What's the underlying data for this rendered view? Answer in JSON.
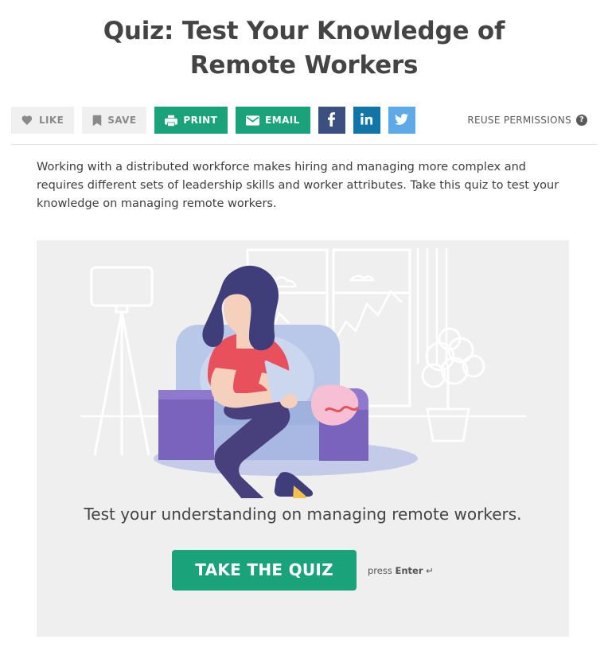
{
  "page": {
    "title": "Quiz: Test Your Knowledge of Remote Workers",
    "intro": "Working with a distributed workforce makes hiring and managing more complex and requires different sets of leadership skills and worker attributes. Take this quiz to test your knowledge on managing remote workers."
  },
  "toolbar": {
    "like_label": "LIKE",
    "save_label": "SAVE",
    "print_label": "PRINT",
    "email_label": "EMAIL",
    "facebook_label": "f",
    "linkedin_label": "in",
    "twitter_label": "twitter-bird",
    "reuse_label": "REUSE PERMISSIONS",
    "reuse_help_glyph": "?",
    "icons": {
      "like": "heart-icon",
      "save": "bookmark-icon",
      "print": "printer-icon",
      "email": "envelope-icon",
      "facebook": "facebook-icon",
      "linkedin": "linkedin-icon",
      "twitter": "twitter-icon",
      "reuse": "question-circle-icon"
    },
    "colors": {
      "gray_button_bg": "#f0f0f0",
      "gray_button_text": "#8a8a8a",
      "green": "#1aa37a",
      "facebook": "#3b4f81",
      "linkedin": "#1275a8",
      "twitter": "#5eaae8"
    }
  },
  "quiz": {
    "caption": "Test your understanding on managing remote workers.",
    "cta_label": "TAKE THE QUIZ",
    "hint_prefix": "press ",
    "hint_key": "Enter",
    "hint_suffix": " ↵",
    "card_bg": "#efefef",
    "illustration": {
      "name": "woman-reading-tablet-in-armchair",
      "colors": {
        "hair": "#3f3d7a",
        "skin": "#f5d0bd",
        "top": "#e8505b",
        "pants": "#47407d",
        "chair_arm": "#7a63bd",
        "chair_back": "#b9c7e8",
        "chair_seat": "#9fb2de",
        "pillow": "#f7bfd4",
        "shadow": "#c3cbe8",
        "shoe": "#3f3d7a",
        "line_art": "#ffffff"
      }
    }
  }
}
